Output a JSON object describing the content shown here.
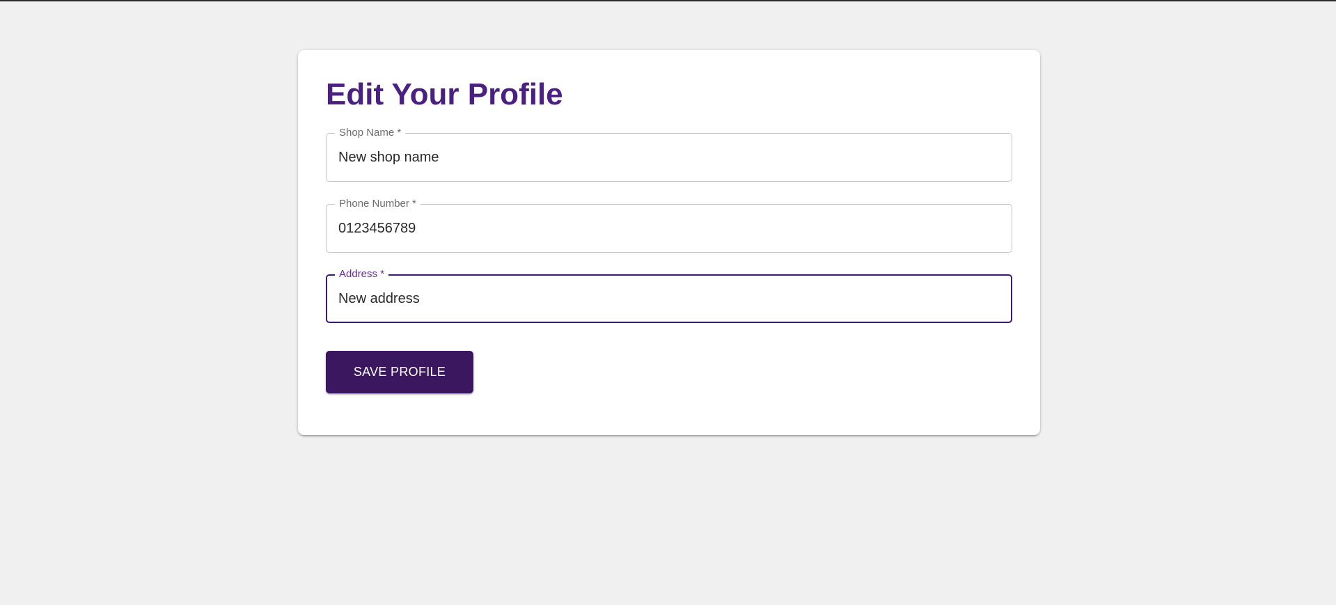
{
  "page": {
    "title": "Edit Your Profile"
  },
  "form": {
    "fields": [
      {
        "label": "Shop Name *",
        "value": "New shop name",
        "focused": false
      },
      {
        "label": "Phone Number *",
        "value": "0123456789",
        "focused": false
      },
      {
        "label": "Address *",
        "value": "New address",
        "focused": true
      }
    ],
    "save_label": "SAVE PROFILE"
  },
  "colors": {
    "page_background": "#f0f0f0",
    "card_background": "#ffffff",
    "title": "#4a2080",
    "focused_border": "#3d1a6e",
    "focused_label": "#6a2a9e",
    "button_background": "#3a175f",
    "button_text": "#ffffff"
  }
}
